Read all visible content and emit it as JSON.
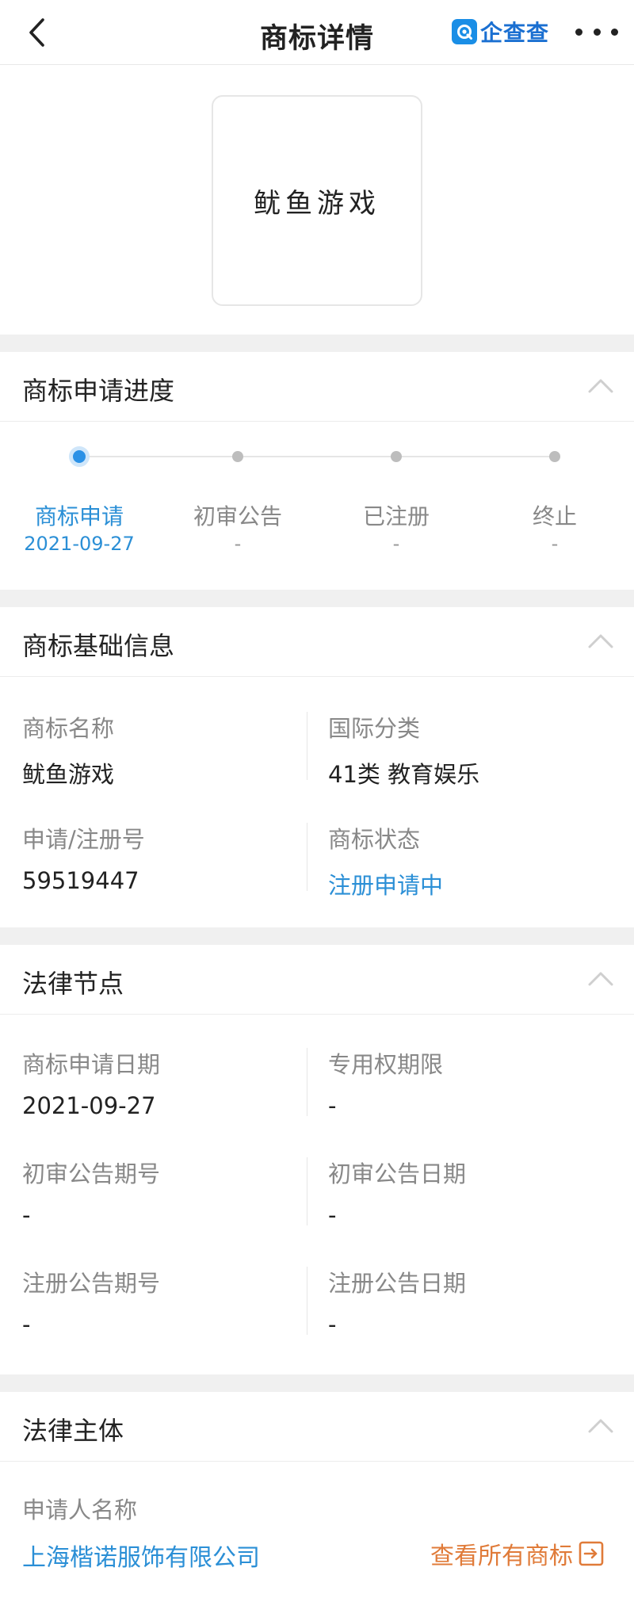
{
  "header": {
    "title": "商标详情",
    "brand": "企查查",
    "back_icon": "chevron-left-icon",
    "more_icon": "more-dots-icon"
  },
  "logo": {
    "text": "鱿鱼游戏"
  },
  "progress_section": {
    "title": "商标申请进度",
    "steps": [
      {
        "label": "商标申请",
        "date": "2021-09-27",
        "active": true
      },
      {
        "label": "初审公告",
        "date": "-",
        "active": false
      },
      {
        "label": "已注册",
        "date": "-",
        "active": false
      },
      {
        "label": "终止",
        "date": "-",
        "active": false
      }
    ]
  },
  "basic_section": {
    "title": "商标基础信息",
    "name_label": "商标名称",
    "name_value": "鱿鱼游戏",
    "class_label": "国际分类",
    "class_value": "41类 教育娱乐",
    "regno_label": "申请/注册号",
    "regno_value": "59519447",
    "status_label": "商标状态",
    "status_value": "注册申请中"
  },
  "legal_section": {
    "title": "法律节点",
    "apply_date_label": "商标申请日期",
    "apply_date_value": "2021-09-27",
    "exclusive_label": "专用权期限",
    "exclusive_value": "-",
    "prelim_no_label": "初审公告期号",
    "prelim_no_value": "-",
    "prelim_date_label": "初审公告日期",
    "prelim_date_value": "-",
    "reg_no_label": "注册公告期号",
    "reg_no_value": "-",
    "reg_date_label": "注册公告日期",
    "reg_date_value": "-"
  },
  "subject_section": {
    "title": "法律主体",
    "applicant_label": "申请人名称",
    "applicant_value": "上海楷诺服饰有限公司",
    "view_all_label": "查看所有商标"
  },
  "colors": {
    "accent_blue": "#2b8fd6",
    "link_orange": "#e07b39",
    "section_gap": "#f0f0f0"
  }
}
